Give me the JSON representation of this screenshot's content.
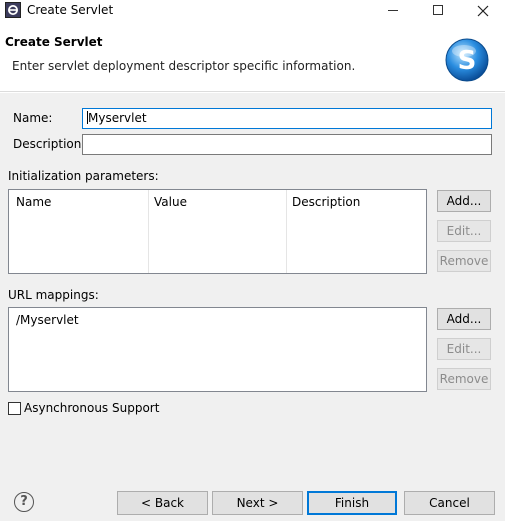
{
  "window": {
    "title": "Create Servlet",
    "app_icon": "eclipse-icon",
    "controls": {
      "minimize": "minimize-icon",
      "maximize": "maximize-icon",
      "close": "close-icon"
    }
  },
  "header": {
    "title": "Create Servlet",
    "description": "Enter servlet deployment descriptor specific information.",
    "logo_icon": "servlet-s-logo-icon",
    "logo_letter": "S"
  },
  "form": {
    "name_label": "Name:",
    "name_value": "Myservlet",
    "description_label": "Description:",
    "description_value": "",
    "init_params_label": "Initialization parameters:",
    "init_params_columns": [
      "Name",
      "Value",
      "Description"
    ],
    "init_params_buttons": {
      "add": "Add...",
      "edit": "Edit...",
      "remove": "Remove"
    },
    "url_mappings_label": "URL mappings:",
    "url_mappings": [
      "/Myservlet"
    ],
    "url_buttons": {
      "add": "Add...",
      "edit": "Edit...",
      "remove": "Remove"
    },
    "async_label": "Asynchronous Support",
    "async_checked": false
  },
  "footer": {
    "help_icon": "help-icon",
    "help_glyph": "?",
    "back": "< Back",
    "next": "Next >",
    "finish": "Finish",
    "cancel": "Cancel"
  },
  "colors": {
    "focus_border": "#0078d7",
    "logo_blue": "#1e88e5",
    "dialog_bg": "#f0f0f0"
  }
}
